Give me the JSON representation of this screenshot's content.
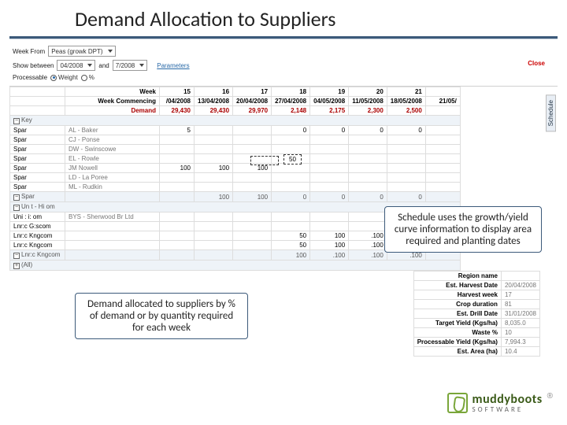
{
  "page": {
    "title": "Demand Allocation to Suppliers"
  },
  "toolbar": {
    "week_from_label": "Week From",
    "week_from_value": "Peas (growk DPT)",
    "show_label": "Show between",
    "date_from": "04/2008",
    "and_label": "and",
    "date_to": "7/2008",
    "params_link": "Parameters",
    "proc_label": "Processable",
    "radio_weight": "Weight",
    "radio_pct": "%",
    "close": "Close"
  },
  "header": {
    "week_label": "Week",
    "weeks": [
      "15",
      "16",
      "17",
      "18",
      "19",
      "20",
      "21"
    ],
    "wc_label": "Week Commencing",
    "wc_dates": [
      "/04/2008",
      "13/04/2008",
      "20/04/2008",
      "27/04/2008",
      "04/05/2008",
      "11/05/2008",
      "18/05/2008",
      "21/05/"
    ],
    "demand_label": "Demand",
    "demand": [
      "29,430",
      "29,430",
      "29,970",
      "2,148",
      "2,175",
      "2,300",
      "2,500"
    ]
  },
  "rows": {
    "group_key": "Key",
    "spar_rows": [
      {
        "name": "Spar",
        "supplier": "AL - Baker",
        "vals": [
          "5",
          "",
          "",
          "0",
          "0",
          "0",
          "0"
        ]
      },
      {
        "name": "Spar",
        "supplier": "CJ - Ponse",
        "vals": [
          "",
          "",
          "",
          "",
          "",
          "",
          ""
        ]
      },
      {
        "name": "Spar",
        "supplier": "DW - Swinscowe",
        "vals": [
          "",
          "",
          "",
          "",
          "",
          "",
          ""
        ]
      },
      {
        "name": "Spar",
        "supplier": "EL - Rowle",
        "vals": [
          "",
          "",
          "",
          "",
          "",
          "",
          ""
        ]
      },
      {
        "name": "Spar",
        "supplier": "JM Nowell",
        "vals": [
          "100",
          "100",
          "100",
          "",
          "",
          "",
          ""
        ]
      },
      {
        "name": "Spar",
        "supplier": "LD - La Poree",
        "vals": [
          "",
          "",
          "",
          "",
          "",
          "",
          ""
        ]
      },
      {
        "name": "Spar",
        "supplier": "ML - Rudkin",
        "vals": [
          "",
          "",
          "",
          "",
          "",
          "",
          ""
        ]
      }
    ],
    "spar_total": {
      "label": "Spar",
      "vals": [
        "100",
        "100",
        "0",
        "0",
        "0",
        "0"
      ]
    },
    "uk_group": "Un t - Hi om",
    "uk_rows": [
      {
        "name": "Uni : i: om",
        "supplier": "BYS - Sherwood Br Ltd",
        "vals": [
          "",
          "",
          "",
          "",
          "",
          "",
          ""
        ]
      },
      {
        "name": "Lnr:c G:scom",
        "supplier": "",
        "vals": [
          "",
          "",
          "",
          "",
          "",
          "",
          ""
        ]
      },
      {
        "name": "Lnr:c Kngcom",
        "supplier": "",
        "vals": [
          "",
          "",
          "50",
          "100",
          ".100",
          ".100"
        ]
      },
      {
        "name": "Lnr:c Kngcom",
        "supplier": "",
        "vals": [
          "",
          "",
          "50",
          "100",
          ".100",
          ".100"
        ]
      }
    ],
    "uk_total": {
      "label": "Lnr:c Kngcom",
      "vals": [
        "",
        "",
        "100",
        ".100",
        ".100",
        ".100"
      ]
    },
    "all_label": "(All)"
  },
  "side": {
    "region_name_label": "Region name",
    "est_harvest_label": "Est. Harvest Date",
    "est_harvest": "20/04/2008",
    "harvest_week_label": "Harvest week",
    "harvest_week": "17",
    "crop_duration_label": "Crop duration",
    "crop_duration": "81",
    "est_drill_label": "Est. Drill Date",
    "est_drill": "31/01/2008",
    "target_yield_label": "Target Yield (Kgs/ha)",
    "target_yield": "8,035.0",
    "waste_label": "Waste %",
    "waste": "10",
    "proc_yield_label": "Processable Yield (Kgs/ha)",
    "proc_yield": "7,994.3",
    "est_area_label": "Est. Area (ha)",
    "est_area": "10.4"
  },
  "highlight": {
    "caption": "50"
  },
  "callouts": {
    "schedule": "Schedule uses the growth/yield curve information to display area required and planting dates",
    "demand": "Demand allocated to suppliers by % of demand or by quantity required for each week"
  },
  "schedule_tab": "Schedule",
  "logo": {
    "brand": "muddyboots",
    "sub": "SOFTWARE"
  }
}
